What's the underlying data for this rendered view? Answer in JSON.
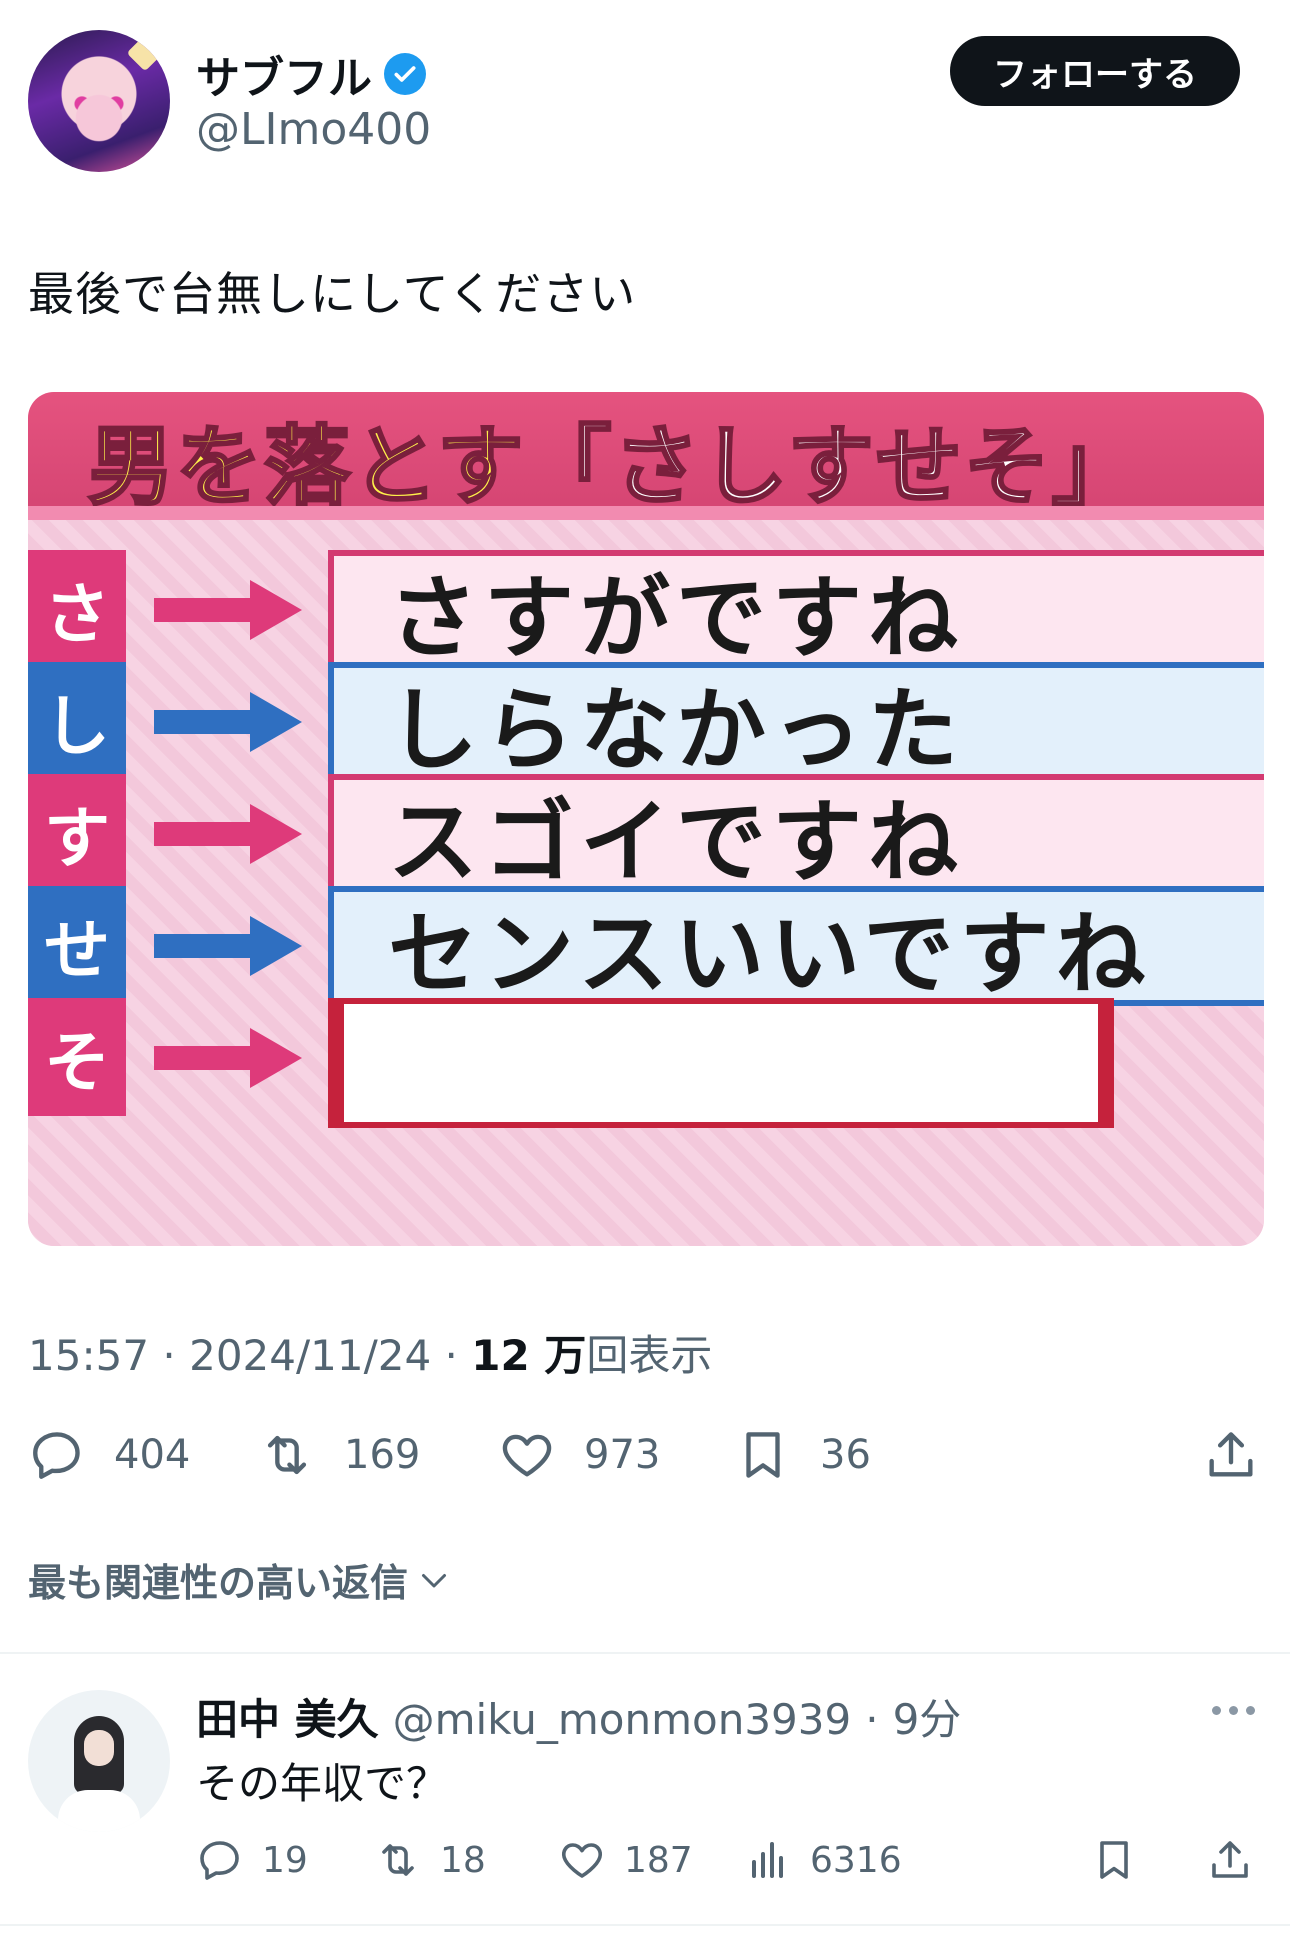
{
  "author": {
    "display_name": "サブフル",
    "handle": "@LImo400",
    "follow_label": "フォローする"
  },
  "tweet": {
    "text": "最後で台無しにしてください",
    "time": "15:57",
    "date": "2024/11/24",
    "views_count": "12 万",
    "views_label": "回表示"
  },
  "media": {
    "title_highlight": "男を落とす",
    "title_rest": "「さしすせそ」",
    "rows": [
      {
        "letter": "さ",
        "answer": "さすがですね",
        "color": "#de3a7a"
      },
      {
        "letter": "し",
        "answer": "しらなかった",
        "color": "#2f6fc1"
      },
      {
        "letter": "す",
        "answer": "スゴイですね",
        "color": "#de3a7a"
      },
      {
        "letter": "せ",
        "answer": "センスいいですね",
        "color": "#2f6fc1"
      },
      {
        "letter": "そ",
        "answer": "",
        "color": "#de3a7a"
      }
    ]
  },
  "actions": {
    "replies": "404",
    "retweets": "169",
    "likes": "973",
    "bookmarks": "36"
  },
  "sort_label": "最も関連性の高い返信",
  "reply": {
    "display_name": "田中 美久",
    "handle": "@miku_monmon3939",
    "time": "9分",
    "text": "その年収で？",
    "replies": "19",
    "retweets": "18",
    "likes": "187",
    "views": "6316"
  },
  "colors": {
    "verified": "#1d9bf0",
    "title_bar": "#d44472",
    "pink": "#de3a7a",
    "blue": "#2f6fc1",
    "blank_border": "#c5223c"
  }
}
